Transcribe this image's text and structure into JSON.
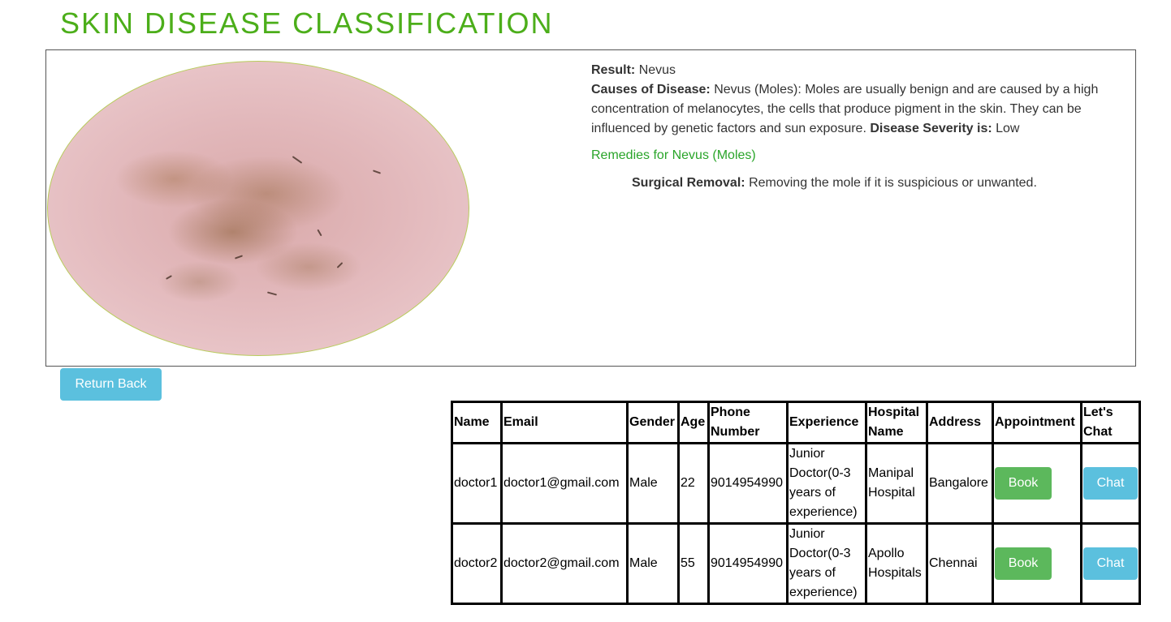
{
  "theme": {
    "title_color": "#4cae1a",
    "remedy_color": "#2aa52a",
    "book_button_color": "#5cb85c",
    "chat_button_color": "#5bc0de"
  },
  "page": {
    "title": "SKIN DISEASE CLASSIFICATION"
  },
  "result": {
    "result_label": "Result:",
    "result_value": "Nevus",
    "causes_label": "Causes of Disease:",
    "causes_text": "Nevus (Moles): Moles are usually benign and are caused by a high concentration of melanocytes, the cells that produce pigment in the skin. They can be influenced by genetic factors and sun exposure.",
    "severity_label": "Disease Severity is:",
    "severity_value": "Low",
    "remedies_heading": "Remedies for Nevus (Moles)",
    "remedy_label": "Surgical Removal:",
    "remedy_text": "Removing the mole if it is suspicious or unwanted."
  },
  "actions": {
    "return_label": "Return Back"
  },
  "table": {
    "headers": {
      "name": "Name",
      "email": "Email",
      "gender": "Gender",
      "age": "Age",
      "phone": "Phone Number",
      "experience": "Experience",
      "hospital": "Hospital Name",
      "address": "Address",
      "appointment": "Appointment",
      "chat": "Let's Chat"
    },
    "rows": [
      {
        "name": "doctor1",
        "email": "doctor1@gmail.com",
        "gender": "Male",
        "age": "22",
        "phone": "9014954990",
        "experience": "Junior Doctor(0-3 years of experience)",
        "hospital": "Manipal Hospital",
        "address": "Bangalore",
        "book_label": "Book",
        "chat_label": "Chat"
      },
      {
        "name": "doctor2",
        "email": "doctor2@gmail.com",
        "gender": "Male",
        "age": "55",
        "phone": "9014954990",
        "experience": "Junior Doctor(0-3 years of experience)",
        "hospital": "Apollo Hospitals",
        "address": "Chennai",
        "book_label": "Book",
        "chat_label": "Chat"
      }
    ]
  }
}
